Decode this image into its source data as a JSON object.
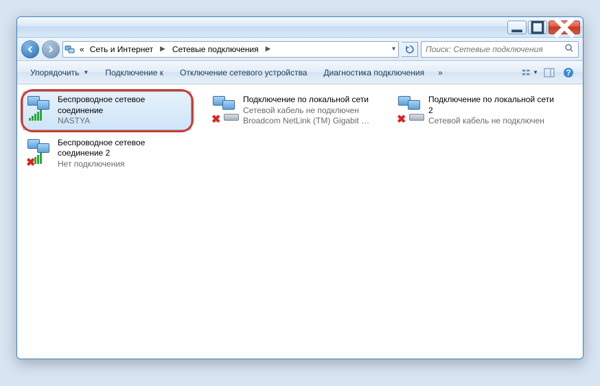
{
  "breadcrumb": {
    "prefix": "«",
    "level1": "Сеть и Интернет",
    "level2": "Сетевые подключения"
  },
  "search": {
    "placeholder": "Поиск: Сетевые подключения"
  },
  "toolbar": {
    "organize": "Упорядочить",
    "connect": "Подключение к",
    "disable": "Отключение сетевого устройства",
    "diagnose": "Диагностика подключения"
  },
  "connections": [
    {
      "title": "Беспроводное сетевое соединение",
      "status": "NASTYA",
      "detail": "",
      "type": "wifi",
      "selected": true,
      "disabled": false,
      "highlight": true
    },
    {
      "title": "Подключение по локальной сети",
      "status": "Сетевой кабель не подключен",
      "detail": "Broadcom NetLink (TM) Gigabit E...",
      "type": "lan",
      "selected": false,
      "disabled": true,
      "highlight": false
    },
    {
      "title": "Подключение по локальной сети 2",
      "status": "Сетевой кабель не подключен",
      "detail": "",
      "type": "lan",
      "selected": false,
      "disabled": true,
      "highlight": false
    },
    {
      "title": "Беспроводное сетевое соединение 2",
      "status": "Нет подключения",
      "detail": "",
      "type": "wifi",
      "selected": false,
      "disabled": true,
      "highlight": false
    }
  ]
}
